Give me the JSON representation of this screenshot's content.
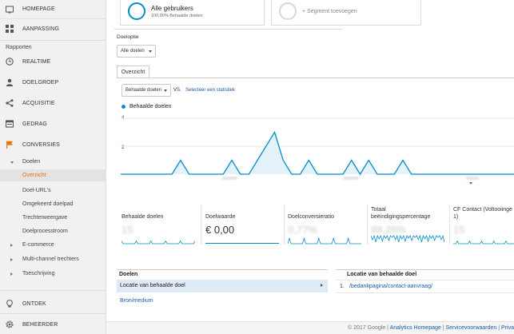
{
  "sidebar": {
    "homepage": "HOMEPAGE",
    "aanpassing": "AANPASSING",
    "section_rapporten": "Rapporten",
    "realtime": "REALTIME",
    "doelgroep": "DOELGROEP",
    "acquisitie": "ACQUISITIE",
    "gedrag": "GEDRAG",
    "conversies": "CONVERSIES",
    "doelen": "Doelen",
    "overzicht": "Overzicht",
    "doel_urls": "Doel-URL's",
    "omgekeerd": "Omgekeerd doelpad",
    "trechter": "Trechterweergave",
    "doelprocesstroom": "Doelprocesstroom",
    "ecommerce": "E-commerce",
    "multichannel": "Multi-channel trechters",
    "toeschrijving": "Toeschrijving",
    "ontdek": "ONTDEK",
    "beheerder": "BEHEERDER"
  },
  "segments": {
    "active_name": "Alle gebruikers",
    "active_sub": "100,00% Behaalde doelen",
    "add_label": "+ Segment toevoegen"
  },
  "controls": {
    "doeloptie_label": "Doeloptie",
    "doeloptie_value": "Alle doelen",
    "tab_overzicht": "Overzicht",
    "metric_select": "Behaalde doelen",
    "vs": "VS.",
    "select_metric_link": "Selecteer een statistiek"
  },
  "chart_data": {
    "type": "line",
    "legend": "Behaalde doelen",
    "y_ticks": [
      "4",
      "2"
    ],
    "ylim": [
      0,
      4
    ],
    "values": [
      0,
      0,
      0,
      0,
      0,
      0,
      0,
      1,
      0,
      0,
      0,
      0,
      0,
      1,
      0,
      0,
      1,
      2,
      3,
      1,
      0,
      0,
      1,
      0,
      0,
      0,
      0,
      1,
      0,
      1,
      0,
      0,
      0,
      1,
      0,
      0,
      0,
      0,
      0,
      0,
      0,
      0,
      0,
      0,
      0,
      0,
      0
    ],
    "grid": true,
    "colors": {
      "line": "#058dc7",
      "fill": "#e6f2f9"
    }
  },
  "kpis": [
    {
      "title": "Behaalde doelen",
      "value": "15"
    },
    {
      "title": "Doelwaarde",
      "value": "€ 0,00"
    },
    {
      "title": "Doelconversieratio",
      "value": "0,77%"
    },
    {
      "title": "Totaal beëindigingspercentage",
      "value": "88,26%"
    },
    {
      "title": "CF Contact (Voltooiinge 1)",
      "value": "15"
    }
  ],
  "goals_table": {
    "left_header": "Doelen",
    "left_rows": [
      "Locatie van behaalde doel",
      "Bron/medium"
    ],
    "right_header": "Locatie van behaalde doel",
    "right_rows": [
      {
        "index": "1.",
        "value": "/bedankpagina/contact-aanvraag/"
      }
    ]
  },
  "footer": {
    "copyright": "© 2017 Google",
    "sep1": "|",
    "link1": "Analytics Homepage",
    "sep2": "|",
    "link2": "Servicevoorwaarden",
    "sep3": "|",
    "link3": "Priva"
  },
  "colors": {
    "accent": "#058dc7",
    "conversies_orange": "#e8710a",
    "link": "#1a5aa6"
  }
}
